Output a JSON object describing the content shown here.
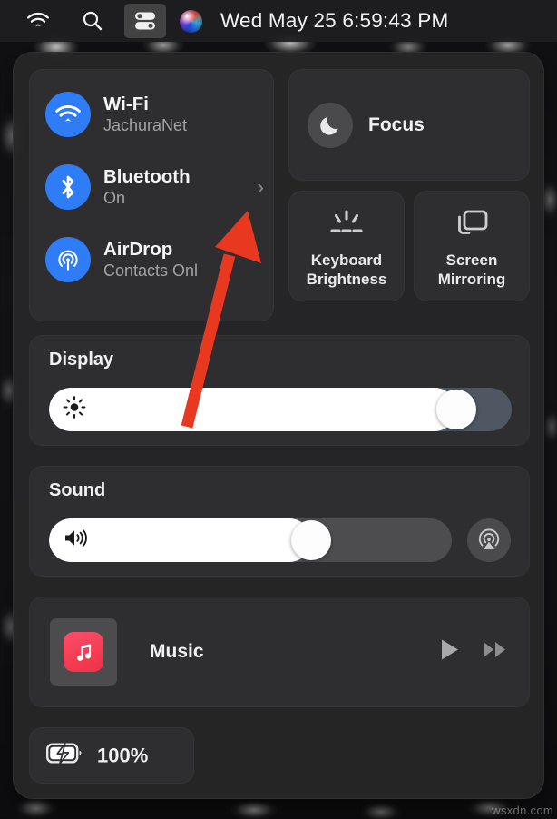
{
  "menubar": {
    "icons": [
      {
        "name": "wifi-icon",
        "label": "Wi-Fi"
      },
      {
        "name": "search-icon",
        "label": "Spotlight Search"
      },
      {
        "name": "control-center-icon",
        "label": "Control Center"
      },
      {
        "name": "siri-icon",
        "label": "Siri"
      }
    ],
    "clock": "Wed May 25  6:59:43 PM"
  },
  "control_center": {
    "connectivity": {
      "wifi": {
        "title": "Wi-Fi",
        "subtitle": "JachuraNet",
        "icon": "wifi-icon"
      },
      "bluetooth": {
        "title": "Bluetooth",
        "subtitle": "On",
        "icon": "bluetooth-icon",
        "chevron": "›"
      },
      "airdrop": {
        "title": "AirDrop",
        "subtitle": "Contacts Onl",
        "icon": "airdrop-icon"
      }
    },
    "focus": {
      "label": "Focus",
      "icon": "moon-icon"
    },
    "tiles": [
      {
        "label": "Keyboard\nBrightness",
        "line1": "Keyboard",
        "line2": "Brightness",
        "icon": "keyboard-brightness-icon"
      },
      {
        "label": "Screen\nMirroring",
        "line1": "Screen",
        "line2": "Mirroring",
        "icon": "screen-mirroring-icon"
      }
    ],
    "display": {
      "title": "Display",
      "value": 88,
      "icon": "brightness-icon"
    },
    "sound": {
      "title": "Sound",
      "value": 65,
      "icon": "speaker-icon",
      "airplay_icon": "airplay-audio-icon"
    },
    "music": {
      "title": "Music",
      "app_icon": "music-app-icon",
      "play_icon": "play-icon",
      "forward_icon": "fast-forward-icon"
    },
    "battery": {
      "percent": "100%",
      "icon": "battery-charging-icon"
    }
  },
  "annotation": {
    "arrow": "red-arrow-pointing-to-bluetooth-chevron",
    "color": "#e8381f"
  },
  "watermark": "wsxdn.com",
  "colors": {
    "accent_blue": "#2e7cf6",
    "panel_bg": "#262628",
    "card_bg": "#2e2e30",
    "music_red": "#ef3145",
    "arrow_red": "#e8381f"
  }
}
